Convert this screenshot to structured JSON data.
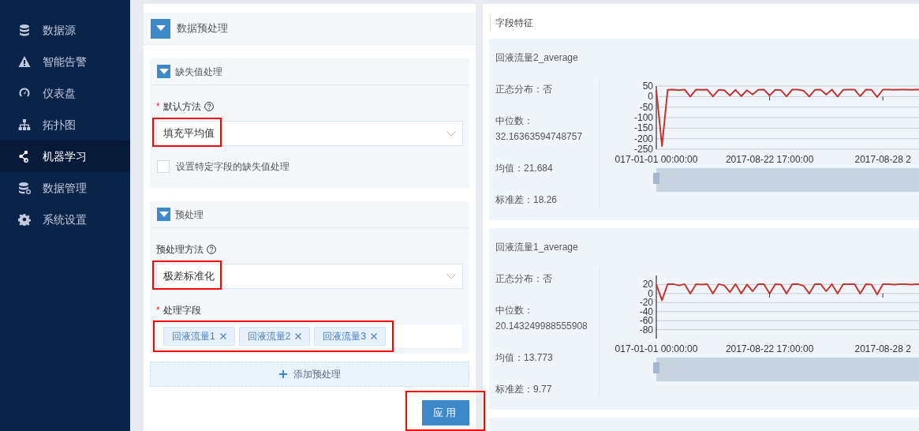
{
  "sidebar": {
    "items": [
      {
        "label": "数据源",
        "selected": false
      },
      {
        "label": "智能告警",
        "selected": false
      },
      {
        "label": "仪表盘",
        "selected": false
      },
      {
        "label": "拓扑图",
        "selected": false
      },
      {
        "label": "机器学习",
        "selected": true
      },
      {
        "label": "数据管理",
        "selected": false
      },
      {
        "label": "系统设置",
        "selected": false
      }
    ]
  },
  "preprocess_panel": {
    "title": "数据预处理",
    "expanded": true,
    "sections": [
      {
        "title": "缺失值处理",
        "expanded": true,
        "fields": [
          {
            "kind": "select",
            "required_mark": "*",
            "label": "默认方法",
            "help": true,
            "value": "填充平均值",
            "highlighted": true
          },
          {
            "kind": "checkbox",
            "label": "设置特定字段的缺失值处理",
            "checked": false
          }
        ]
      },
      {
        "title": "预处理",
        "expanded": true,
        "fields": [
          {
            "kind": "select",
            "label": "预处理方法",
            "help": true,
            "value": "极差标准化",
            "highlighted": true
          },
          {
            "kind": "tags",
            "required_mark": "*",
            "label": "处理字段",
            "tags": [
              "回液流量1",
              "回液流量2",
              "回液流量3"
            ],
            "highlighted": true
          }
        ]
      }
    ],
    "add_button": {
      "label": "添加预处理"
    },
    "apply_button": {
      "label": "应用",
      "highlighted": true
    }
  },
  "features_panel": {
    "title": "字段特征",
    "cards": [
      {
        "title": "回液流量2_average",
        "stats": [
          {
            "label": "正态分布：",
            "value": "否"
          },
          {
            "label": "中位数：",
            "value": "32.16363594748757"
          },
          {
            "label": "均值：",
            "value": "21.684"
          },
          {
            "label": "标准差：",
            "value": "18.26"
          }
        ],
        "chart_data": {
          "type": "line",
          "categories": [
            "017-01-01 00:00:00",
            null,
            null,
            null,
            null,
            null,
            null,
            null,
            null,
            null,
            null,
            null,
            null,
            null,
            null,
            null,
            null,
            null,
            null,
            null,
            "2017-08-22 17:00:00",
            null,
            null,
            null,
            null,
            null,
            null,
            null,
            null,
            null,
            null,
            null,
            null,
            null,
            null,
            null,
            null,
            null,
            null,
            null,
            "2017-08-28 2",
            null,
            null,
            null,
            null,
            null,
            null,
            null
          ],
          "series": [
            {
              "color": "#c23531",
              "values": [
                30,
                -235,
                32,
                33,
                30,
                33,
                0,
                33,
                32,
                33,
                1,
                32,
                30,
                5,
                32,
                2,
                30,
                10,
                32,
                33,
                5,
                32,
                30,
                1,
                33,
                33,
                28,
                0,
                32,
                33,
                10,
                33,
                0,
                32,
                33,
                33,
                2,
                33,
                32,
                -2,
                33,
                33,
                32,
                33,
                33,
                32,
                33,
                33
              ]
            }
          ],
          "grid": true,
          "ylim": [
            -250,
            50
          ],
          "yticks": [
            50,
            0,
            -50,
            -100,
            -150,
            -200,
            -250
          ]
        }
      },
      {
        "title": "回液流量1_average",
        "stats": [
          {
            "label": "正态分布：",
            "value": "否"
          },
          {
            "label": "中位数：",
            "value": "20.143249988555908"
          },
          {
            "label": "均值：",
            "value": "13.773"
          },
          {
            "label": "标准差：",
            "value": "9.77"
          }
        ],
        "chart_data": {
          "type": "line",
          "categories": [
            "017-01-01 00:00:00",
            null,
            null,
            null,
            null,
            null,
            null,
            null,
            null,
            null,
            null,
            null,
            null,
            null,
            null,
            null,
            null,
            null,
            null,
            null,
            "2017-08-22 17:00:00",
            null,
            null,
            null,
            null,
            null,
            null,
            null,
            null,
            null,
            null,
            null,
            null,
            null,
            null,
            null,
            null,
            null,
            null,
            null,
            "2017-08-28 2",
            null,
            null,
            null,
            null,
            null,
            null,
            null
          ],
          "series": [
            {
              "color": "#c23531",
              "values": [
                20,
                -15,
                21,
                21,
                18,
                21,
                0,
                21,
                20,
                21,
                0,
                21,
                18,
                3,
                21,
                0,
                20,
                5,
                21,
                21,
                0,
                21,
                20,
                0,
                21,
                21,
                17,
                0,
                21,
                21,
                5,
                21,
                0,
                21,
                21,
                21,
                0,
                21,
                20,
                -2,
                21,
                21,
                20,
                21,
                21,
                20,
                21,
                21
              ]
            }
          ],
          "grid": true,
          "ylim": [
            -100,
            40
          ],
          "yticks": [
            20,
            0,
            -20,
            -40,
            -60,
            -80
          ]
        }
      }
    ]
  }
}
